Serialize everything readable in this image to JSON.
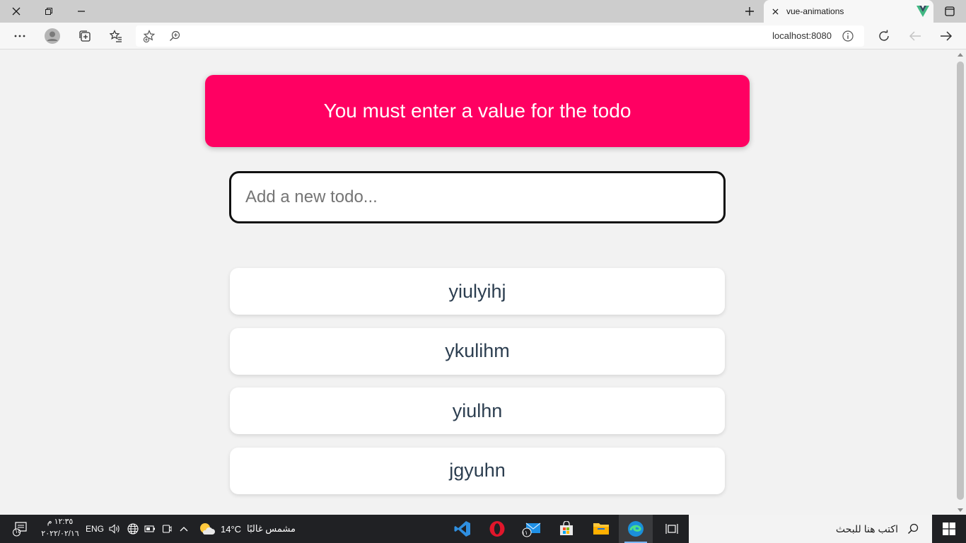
{
  "browser": {
    "tab": {
      "title": "vue-animations",
      "favicon": "vue-logo-icon"
    },
    "address": {
      "url": "localhost:8080"
    }
  },
  "page": {
    "error_message": "You must enter a value for the todo",
    "input": {
      "placeholder": "Add a new todo...",
      "value": ""
    },
    "todos": [
      "yiulyihj",
      "ykulihm",
      "yiulhn",
      "jgyuhn"
    ]
  },
  "taskbar": {
    "search_placeholder": "اكتب هنا للبحث",
    "weather_temp": "14°C",
    "weather_text": "مشمس غالبًا",
    "language": "ENG",
    "time": "١٢:٣٥ م",
    "date": "٢٠٢٢/٠٢/١٦",
    "notification_count": "١٥",
    "mail_badge": "١١"
  },
  "colors": {
    "banner": "#ff0062",
    "page_bg": "#f2f2f2",
    "todo_text": "#2c3e50"
  }
}
